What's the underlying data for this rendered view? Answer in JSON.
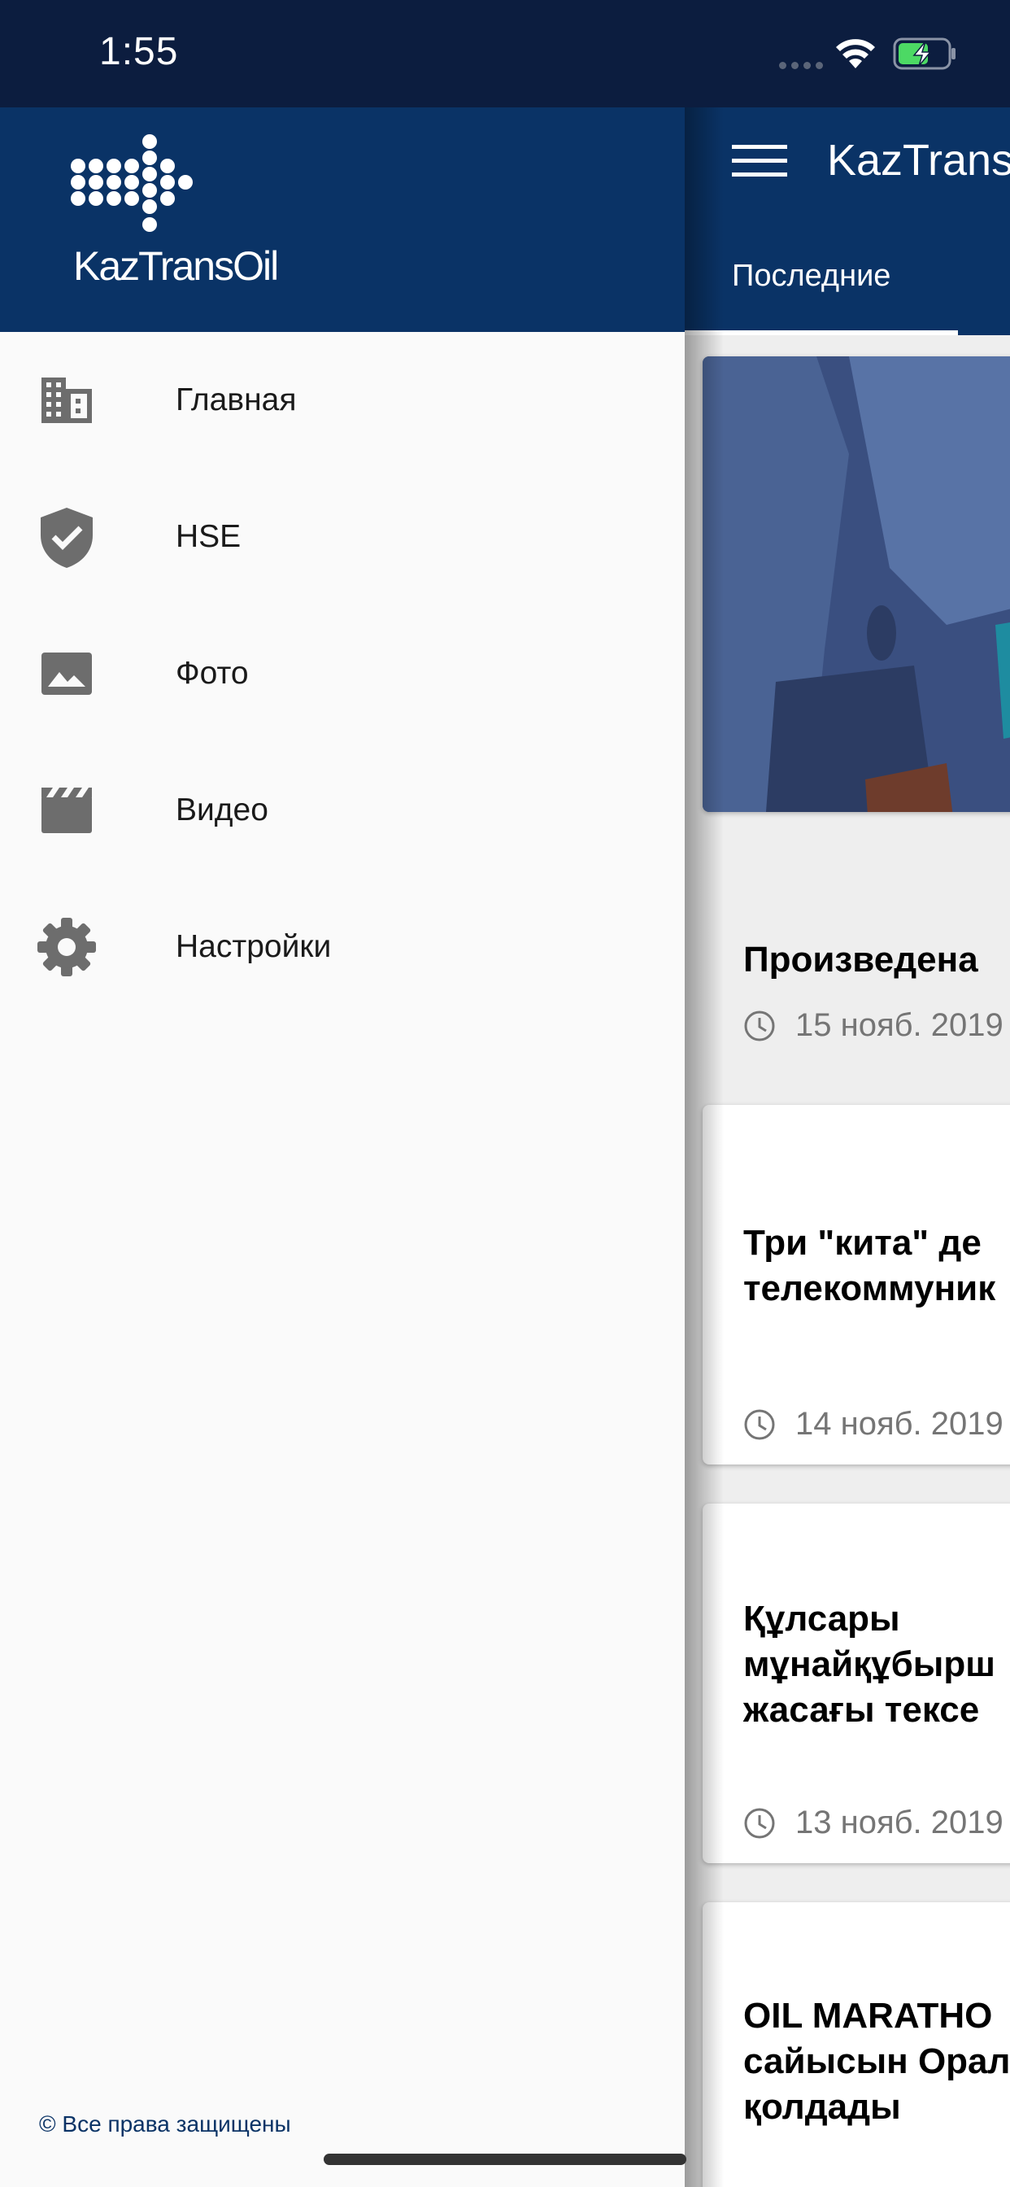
{
  "status_bar": {
    "time": "1:55"
  },
  "drawer": {
    "logo_text": "KazTransOil",
    "items": [
      {
        "label": "Главная",
        "icon": "building-icon"
      },
      {
        "label": "HSE",
        "icon": "shield-check-icon"
      },
      {
        "label": "Фото",
        "icon": "photo-icon"
      },
      {
        "label": "Видео",
        "icon": "video-clapper-icon"
      },
      {
        "label": "Настройки",
        "icon": "gear-icon"
      }
    ],
    "copyright": "© Все права защищены"
  },
  "main": {
    "app_title": "KazTransOil",
    "tab": "Последние",
    "cards": [
      {
        "title": "Произведена",
        "date": "15 нояб. 2019"
      },
      {
        "title": "Три \"кита\" де\nтелекоммуник",
        "date": "14 нояб. 2019"
      },
      {
        "title": "Құлсары\nмұнайқұбырш\nжасағы тексе",
        "date": "13 нояб. 2019"
      },
      {
        "title": "OIL MARATHO\nсайысын Орал\nқолдады",
        "date": ""
      }
    ]
  },
  "colors": {
    "primary": "#0a3366",
    "status_bar": "#0c1d3f",
    "icon_gray": "#6d6d6d"
  }
}
